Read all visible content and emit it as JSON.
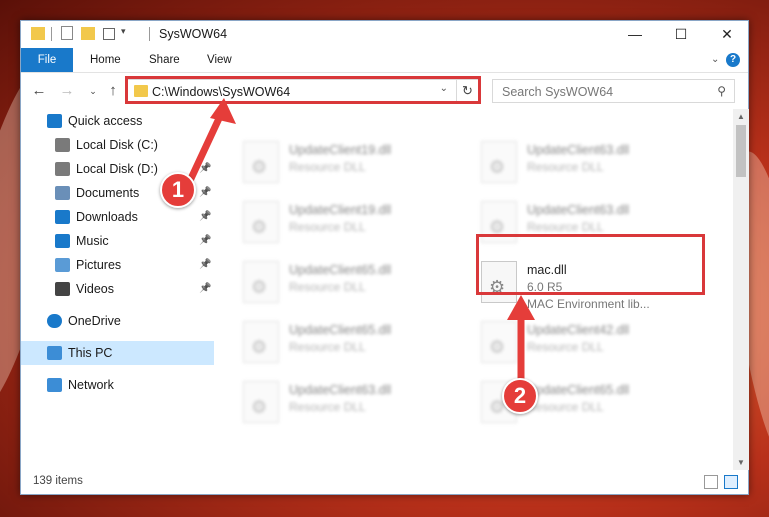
{
  "window": {
    "title": "SysWOW64"
  },
  "ribbon": {
    "tabs": [
      "File",
      "Home",
      "Share",
      "View"
    ],
    "help": "?"
  },
  "caption": {
    "minimize": "—",
    "maximize": "☐",
    "close": "✕"
  },
  "address": {
    "path": "C:\\Windows\\SysWOW64"
  },
  "search": {
    "placeholder": "Search SysWOW64"
  },
  "navpane": {
    "items": [
      {
        "label": "Quick access",
        "icon": "star-icon",
        "pinned": false,
        "selected": false
      },
      {
        "label": "Local Disk (C:)",
        "icon": "drive-icon",
        "pinned": false,
        "selected": false
      },
      {
        "label": "Local Disk (D:)",
        "icon": "drive-icon",
        "pinned": true,
        "selected": false
      },
      {
        "label": "Documents",
        "icon": "documents-icon",
        "pinned": true,
        "selected": false
      },
      {
        "label": "Downloads",
        "icon": "downloads-icon",
        "pinned": true,
        "selected": false
      },
      {
        "label": "Music",
        "icon": "music-icon",
        "pinned": true,
        "selected": false
      },
      {
        "label": "Pictures",
        "icon": "pictures-icon",
        "pinned": true,
        "selected": false
      },
      {
        "label": "Videos",
        "icon": "videos-icon",
        "pinned": true,
        "selected": false
      },
      {
        "label": "OneDrive",
        "icon": "onedrive-icon",
        "pinned": false,
        "selected": false
      },
      {
        "label": "This PC",
        "icon": "computer-icon",
        "pinned": false,
        "selected": true
      },
      {
        "label": "Network",
        "icon": "network-icon",
        "pinned": false,
        "selected": false
      }
    ]
  },
  "files": {
    "left": [
      {
        "name": "UpdateClient19.dll",
        "type": "Resource DLL"
      },
      {
        "name": "UpdateClient19.dll",
        "type": "Resource DLL"
      },
      {
        "name": "UpdateClient65.dll",
        "type": "Resource DLL"
      },
      {
        "name": "UpdateClient65.dll",
        "type": "Resource DLL"
      },
      {
        "name": "UpdateClient63.dll",
        "type": "Resource DLL"
      }
    ],
    "right": [
      {
        "name": "UpdateClient63.dll",
        "type": "Resource DLL"
      },
      {
        "name": "UpdateClient63.dll",
        "type": "Resource DLL"
      },
      {
        "name": "UpdateClient42.dll",
        "type": "Resource DLL"
      },
      {
        "name": "UpdateClient65.dll",
        "type": "Resource DLL"
      }
    ],
    "highlighted": {
      "name": "mac.dll",
      "version": "6.0 R5",
      "description": "MAC Environment lib..."
    }
  },
  "status": {
    "count": "139 items"
  },
  "callouts": [
    "1",
    "2"
  ],
  "colors": {
    "accent": "#1979ca",
    "highlight": "#d9383a",
    "callout": "#e53d3a",
    "selected": "#cce8ff"
  }
}
